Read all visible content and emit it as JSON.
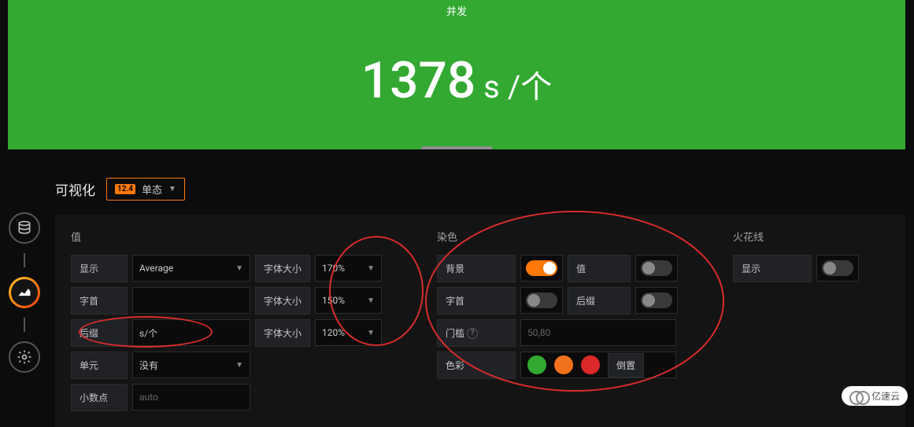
{
  "preview": {
    "title": "并发",
    "value": "1378",
    "unit": " s /个"
  },
  "tabs": {
    "label": "可视化",
    "picker_badge": "12.4",
    "picker_text": "单态"
  },
  "sections": {
    "value": {
      "title": "值",
      "show_label": "显示",
      "show_value": "Average",
      "prefix_label": "字首",
      "prefix_value": "",
      "postfix_label": "后缀",
      "postfix_value": "s/个",
      "unit_label": "单元",
      "unit_value": "没有",
      "decimals_label": "小数点",
      "decimals_placeholder": "auto",
      "fontsize_label": "字体大小",
      "fontsize_value": "170%",
      "fontsize_prefix": "150%",
      "fontsize_postfix": "120%"
    },
    "coloring": {
      "title": "染色",
      "background_label": "背景",
      "background_on": true,
      "value_label": "值",
      "value_on": false,
      "prefix_label": "字首",
      "prefix_on": false,
      "postfix_label": "后缀",
      "postfix_on": false,
      "thresholds_label": "门槛",
      "thresholds_placeholder": "50,80",
      "colors_label": "色彩",
      "colors": [
        "green",
        "orange",
        "red"
      ],
      "invert_label": "倒置"
    },
    "spark": {
      "title": "火花线",
      "show_label": "显示",
      "show_on": false
    }
  },
  "watermark": "亿速云",
  "colors": {
    "accent": "#33a932",
    "orange": "#ff780a"
  }
}
